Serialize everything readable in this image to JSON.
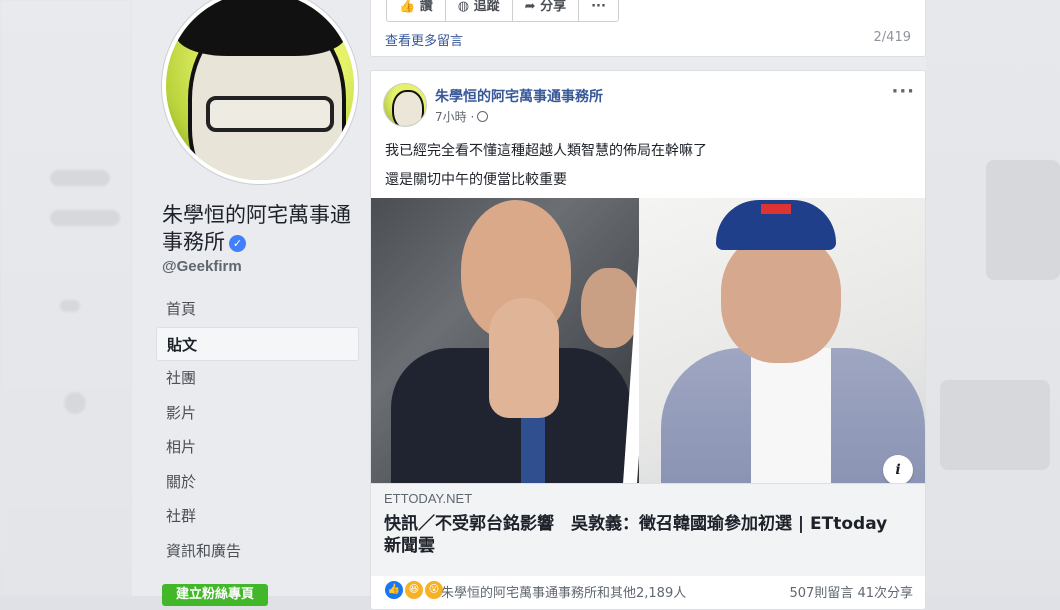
{
  "page": {
    "name": "朱學恒的阿宅萬事通事務所",
    "handle": "@Geekfirm"
  },
  "nav": {
    "items": [
      "首頁",
      "貼文",
      "社團",
      "影片",
      "相片",
      "關於",
      "社群",
      "資訊和廣告"
    ],
    "active": "貼文"
  },
  "bottom_button": {
    "label": "建立粉絲專頁"
  },
  "top_card": {
    "actions": [
      "讚",
      "追蹤",
      "分享",
      "···"
    ],
    "more_comments": "查看更多留言",
    "comment_count": "2/419"
  },
  "post": {
    "author": "朱學恒的阿宅萬事通事務所",
    "time": "7小時 ·",
    "menu": "···",
    "text_lines": [
      "我已經完全看不懂這種超越人類智慧的佈局在幹嘛了",
      "還是關切中午的便當比較重要"
    ],
    "link": {
      "domain": "ETTODAY.NET",
      "title": "快訊／不受郭台銘影響　吳敦義：徵召韓國瑜參加初選 | ETtoday新聞雲"
    },
    "info_icon_label": "i",
    "reactions_text": "朱學恒的阿宅萬事通事務所和其他2,189人",
    "comments_shares": "507則留言  41次分享"
  },
  "icons": {
    "verified": "verified-badge-icon",
    "globe": "globe-icon",
    "like": "like-reaction-icon",
    "haha": "haha-reaction-icon",
    "wow": "wow-reaction-icon"
  }
}
